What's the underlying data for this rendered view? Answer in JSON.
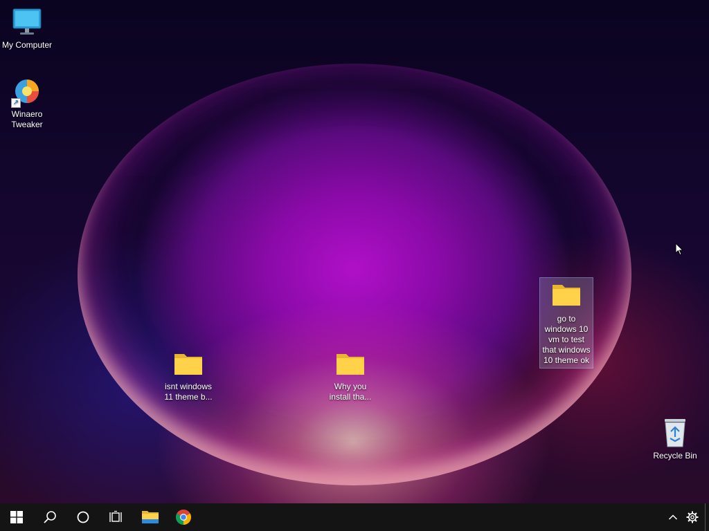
{
  "desktop": {
    "icons": [
      {
        "label": "My Computer",
        "icon": "computer-icon"
      },
      {
        "label": "Winaero Tweaker",
        "icon": "winaero-tweaker-icon",
        "shortcut": true
      },
      {
        "label": "isnt windows 11 theme b...",
        "icon": "folder-icon"
      },
      {
        "label": "Why you install tha...",
        "icon": "folder-icon"
      },
      {
        "label": "go to windows 10 vm to test that windows 10 theme ok",
        "icon": "folder-icon",
        "selected": true
      },
      {
        "label": "Recycle Bin",
        "icon": "recycle-bin-icon"
      }
    ]
  },
  "taskbar": {
    "buttons": [
      {
        "name": "start",
        "icon": "windows-logo-icon"
      },
      {
        "name": "search",
        "icon": "search-icon"
      },
      {
        "name": "cortana",
        "icon": "cortana-circle-icon"
      },
      {
        "name": "task-view",
        "icon": "task-view-icon"
      },
      {
        "name": "file-explorer",
        "icon": "file-explorer-icon"
      },
      {
        "name": "chrome",
        "icon": "chrome-icon"
      }
    ],
    "tray": [
      {
        "name": "show-hidden-icons",
        "icon": "chevron-up-icon"
      },
      {
        "name": "settings",
        "icon": "gear-icon"
      }
    ]
  },
  "colors": {
    "taskbar_bg": "#141414",
    "folder_yellow": "#ffd24a",
    "accent_blue": "#1a6fd8"
  }
}
